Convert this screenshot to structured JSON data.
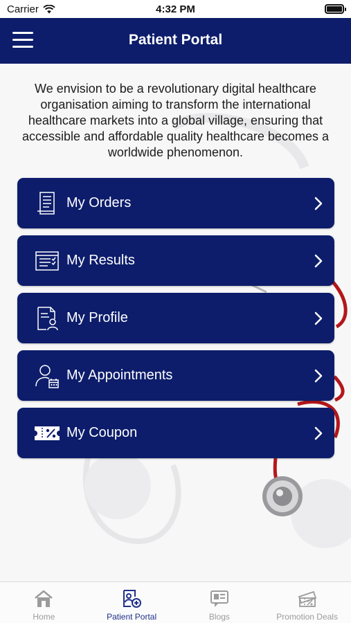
{
  "status_bar": {
    "carrier": "Carrier",
    "time": "4:32 PM"
  },
  "nav": {
    "title": "Patient Portal",
    "menu_icon": "hamburger-menu-icon"
  },
  "intro_text": "We envision to be a revolutionary digital healthcare organisation aiming to transform the international healthcare markets into a global village, ensuring that accessible and affordable quality healthcare becomes a worldwide phenomenon.",
  "menu": {
    "items": [
      {
        "label": "My Orders",
        "icon": "receipt-icon"
      },
      {
        "label": "My Results",
        "icon": "results-report-icon"
      },
      {
        "label": "My Profile",
        "icon": "profile-document-icon"
      },
      {
        "label": "My Appointments",
        "icon": "user-calendar-icon"
      },
      {
        "label": "My Coupon",
        "icon": "coupon-percent-icon"
      }
    ]
  },
  "tabs": [
    {
      "label": "Home",
      "icon": "home-icon",
      "active": false
    },
    {
      "label": "Patient Portal",
      "icon": "patient-portal-icon",
      "active": true
    },
    {
      "label": "Blogs",
      "icon": "blogs-icon",
      "active": false
    },
    {
      "label": "Promotion Deals",
      "icon": "promotion-deals-icon",
      "active": false
    }
  ],
  "colors": {
    "primary": "#0d1d6b",
    "tab_active": "#1f2f8a",
    "tab_inactive": "#9b9b9b",
    "stethoscope": "#b3171b"
  }
}
